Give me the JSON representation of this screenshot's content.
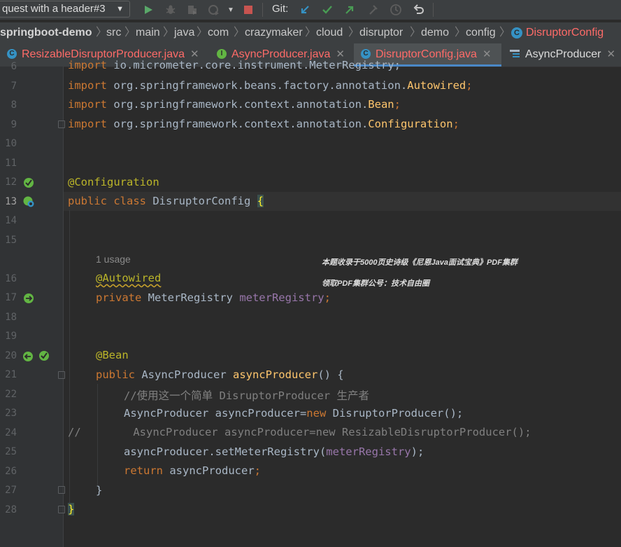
{
  "toolbar": {
    "run_config": "quest with a header#3",
    "git_label": "Git:",
    "icons": [
      "run-icon",
      "debug-icon",
      "coverage-icon",
      "profile-icon",
      "more-run-icon",
      "stop-icon",
      "git-update-icon",
      "git-commit-icon",
      "git-push-icon",
      "git-merge-icon",
      "history-icon",
      "rollback-icon"
    ]
  },
  "breadcrumb": {
    "items": [
      "springboot-demo",
      "src",
      "main",
      "java",
      "com",
      "crazymaker",
      "cloud",
      "disruptor",
      "demo",
      "config",
      "DisruptorConfig"
    ]
  },
  "tabs": [
    {
      "label": "ResizableDisruptorProducer.java",
      "icon": "class-icon"
    },
    {
      "label": "AsyncProducer.java",
      "icon": "interface-icon"
    },
    {
      "label": "DisruptorConfig.java",
      "icon": "class-icon",
      "active": true
    },
    {
      "label": "AsyncProducer",
      "icon": "structure-icon"
    }
  ],
  "editor": {
    "line_numbers": [
      "6",
      "7",
      "8",
      "9",
      "10",
      "11",
      "12",
      "13",
      "14",
      "15",
      "16",
      "17",
      "18",
      "19",
      "20",
      "21",
      "22",
      "23",
      "24",
      "25",
      "26",
      "27",
      "28"
    ],
    "hint_usage": "1 usage",
    "watermark_line1": "本题收录于5000页史诗级《尼恩Java面试宝典》PDF集群",
    "watermark_line2": "领取PDF集群公号：技术自由圈",
    "tokens": {
      "import": "import",
      "l6_pkg": " io.micrometer.core.instrument.MeterRegistry;",
      "l7_pkg": " org.springframework.beans.factory.annotation.",
      "l7_cls": "Autowired",
      "l8_pkg": " org.springframework.context.annotation.",
      "l8_cls": "Bean",
      "l9_pkg": " org.springframework.context.annotation.",
      "l9_cls": "Configuration",
      "semi": ";",
      "l12_ann": "@Configuration",
      "public": "public",
      "class": "class",
      "l13_name": " DisruptorConfig ",
      "open_brace": "{",
      "l16_ann": "@Autowired",
      "private": "private",
      "l17_type": " MeterRegistry ",
      "l17_field": "meterRegistry",
      "l20_ann": "@Bean",
      "l21_type": " AsyncProducer ",
      "l21_method": "asyncProducer",
      "l21_rest": "() {",
      "l22_comment": "//使用这一个简单 DisruptorProducer 生产者",
      "l23_pre": "AsyncProducer asyncProducer=",
      "new": "new",
      "l23_post": " DisruptorProducer();",
      "l24_comment": "//        AsyncProducer asyncProducer=new ResizableDisruptorProducer();",
      "l25_pre": "asyncProducer.setMeterRegistry(",
      "l25_field": "meterRegistry",
      "l25_post": ");",
      "return": "return",
      "l26_post": " asyncProducer",
      "close_brace": "}",
      "close_brace_final": "}"
    }
  },
  "colors": {
    "background": "#2b2b2b",
    "keyword": "#cc7832",
    "annotation": "#bbb529",
    "field": "#9876aa",
    "method": "#ffc66d",
    "comment": "#808080",
    "active_tab_underline": "#4a88c7",
    "breadcrumb_current": "#ff6b68"
  }
}
